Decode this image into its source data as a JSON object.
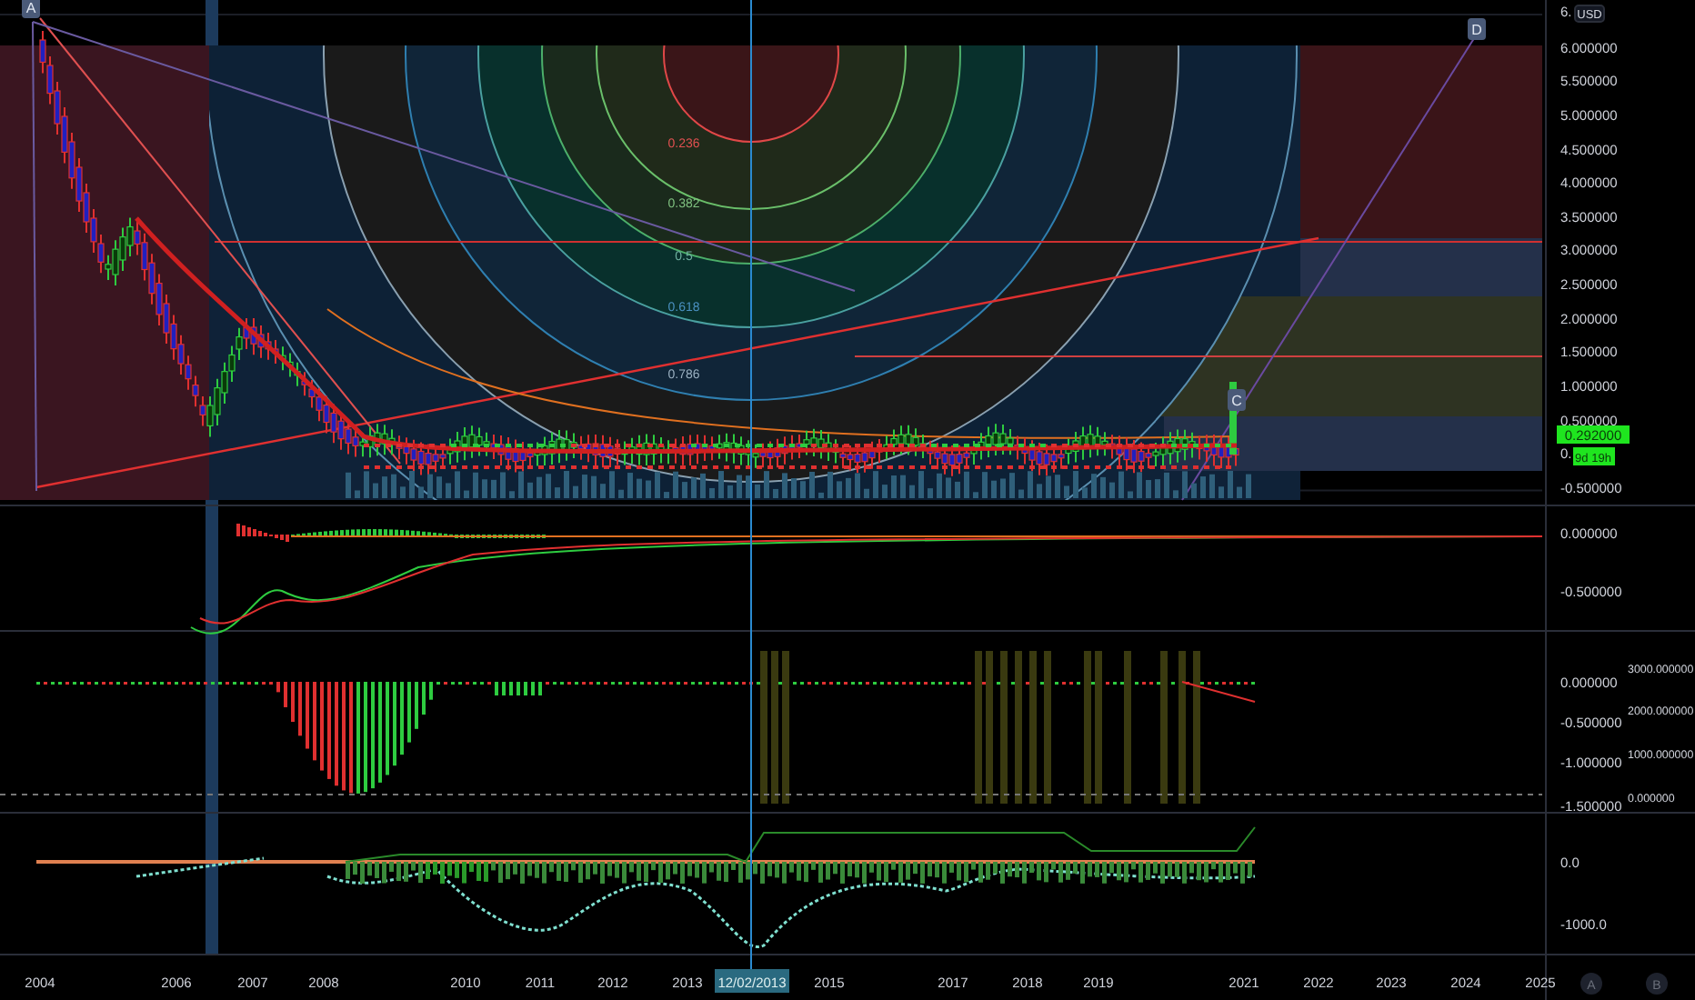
{
  "chart": {
    "markers": [
      {
        "label": "A"
      },
      {
        "label": "C"
      },
      {
        "label": "D"
      }
    ],
    "fib_levels": [
      "0.236",
      "0.382",
      "0.5",
      "0.618",
      "0.786"
    ]
  },
  "price_axis": {
    "currency": "USD",
    "main": [
      "6.",
      "6.000000",
      "5.500000",
      "5.000000",
      "4.500000",
      "4.000000",
      "3.500000",
      "3.000000",
      "2.500000",
      "2.000000",
      "1.500000",
      "1.000000",
      "0.500000",
      "0.",
      "-0.500000"
    ],
    "last_price": "0.292000",
    "countdown": "9d 19h",
    "pane_2": [
      "0.000000",
      "-0.500000"
    ],
    "pane_3": [
      "0.000000",
      "-0.500000",
      "-1.000000",
      "-1.500000"
    ],
    "pane_3_volume": [
      "3000.000000",
      "2000.000000",
      "1000.000000",
      "0.000000"
    ],
    "pane_4": [
      "0.0",
      "-1000.0"
    ]
  },
  "time_axis": {
    "labels": [
      "2004",
      "2006",
      "2007",
      "2008",
      "2010",
      "2011",
      "2012",
      "2013",
      "2015",
      "2017",
      "2018",
      "2019",
      "2021",
      "2022",
      "2023",
      "2024",
      "2025"
    ],
    "crosshair_date": "12/02/2013"
  },
  "scale_buttons": [
    {
      "label": "A"
    },
    {
      "label": "B"
    }
  ]
}
